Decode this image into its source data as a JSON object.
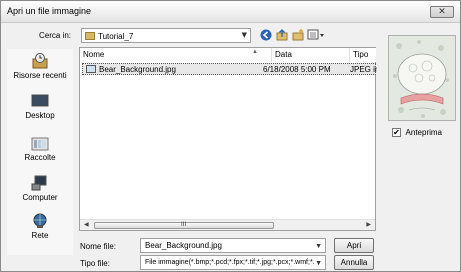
{
  "window": {
    "title": "Apri un file immagine",
    "close_glyph": "✕"
  },
  "lookin": {
    "label": "Cerca in:",
    "value": "Tutorial_7"
  },
  "toolbar": {
    "back_icon": "back-icon",
    "up_icon": "up-folder-icon",
    "newfolder_icon": "new-folder-icon",
    "views_icon": "views-menu-icon"
  },
  "places": [
    {
      "label": "Risorse recenti",
      "icon": "recent-places-icon"
    },
    {
      "label": "Desktop",
      "icon": "desktop-icon"
    },
    {
      "label": "Raccolte",
      "icon": "libraries-icon"
    },
    {
      "label": "Computer",
      "icon": "computer-icon"
    },
    {
      "label": "Rete",
      "icon": "network-icon"
    }
  ],
  "filelist": {
    "columns": [
      "Nome",
      "Data",
      "Tipo"
    ],
    "rows": [
      {
        "name": "Bear_Background.jpg",
        "date": "6/18/2008 5:00 PM",
        "type": "JPEG imag"
      }
    ],
    "scroll_grip": "III"
  },
  "preview": {
    "checkbox_label": "Anteprima",
    "checked": true
  },
  "filename": {
    "label": "Nome file:",
    "value": "Bear_Background.jpg"
  },
  "filetype": {
    "label": "Tipo file:",
    "value": "File immagine(*.bmp;*.pcd;*.fpx;*.tif;*.jpg;*.pcx;*.wmf;*."
  },
  "buttons": {
    "open": "Apri",
    "cancel": "Annulla"
  }
}
